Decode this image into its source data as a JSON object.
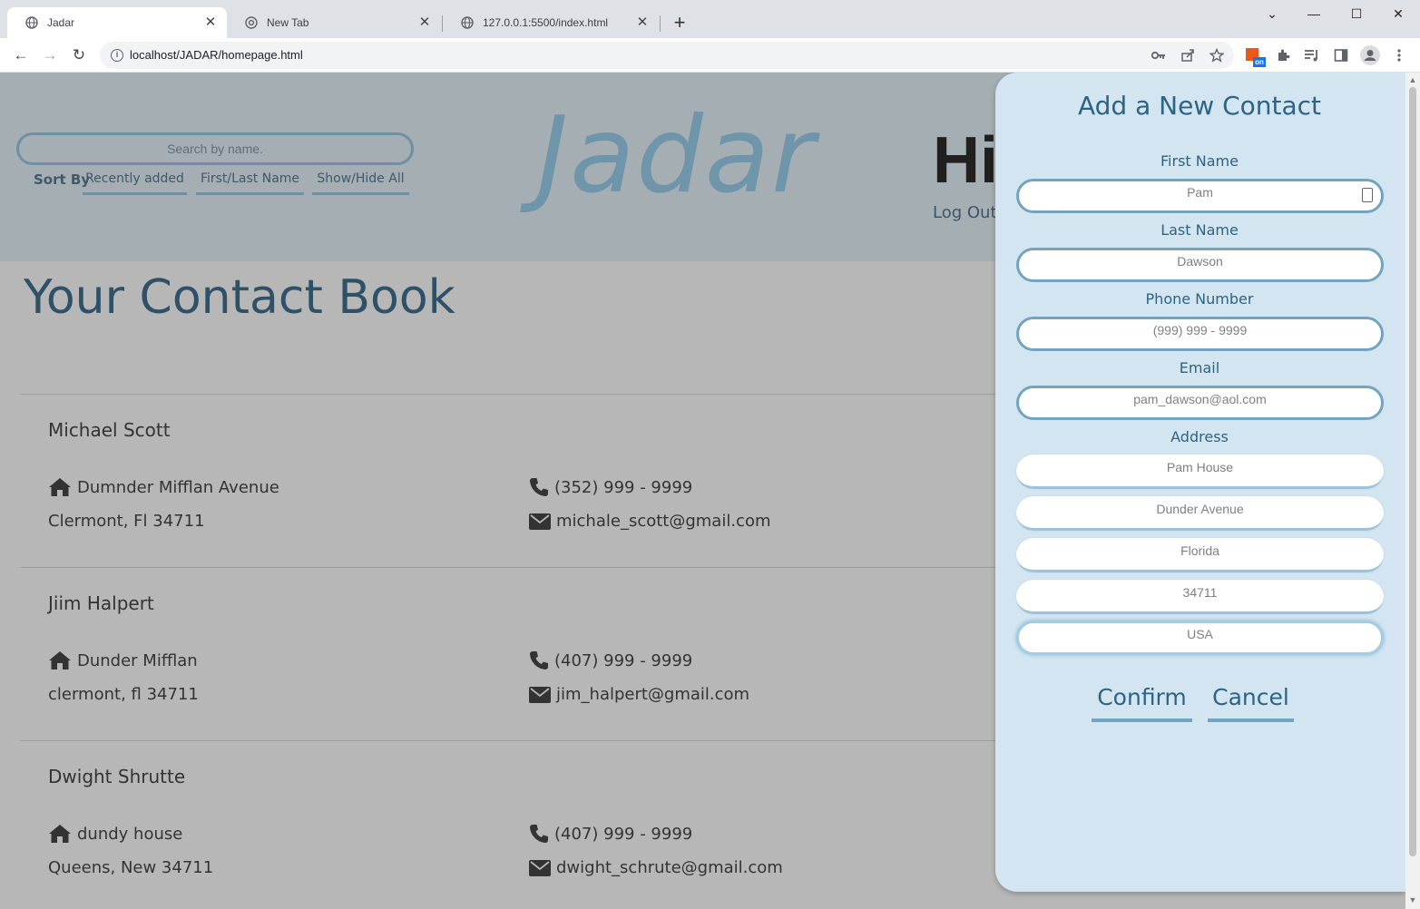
{
  "browser": {
    "tabs": [
      {
        "title": "Jadar",
        "close": "✕"
      },
      {
        "title": "New Tab",
        "close": "✕"
      },
      {
        "title": "127.0.0.1:5500/index.html",
        "close": "✕"
      }
    ],
    "new_tab": "+",
    "window": {
      "chevron": "⌄",
      "minimize": "—",
      "maximize": "☐",
      "close": "✕"
    },
    "nav": {
      "back": "←",
      "forward": "→",
      "reload": "↻"
    },
    "url": "localhost/JADAR/homepage.html",
    "info": "i",
    "icons": [
      "key-icon",
      "share-icon",
      "star-icon",
      "extension-on-icon",
      "puzzle-icon",
      "media-icon",
      "side-panel-icon",
      "profile-icon",
      "menu-icon"
    ],
    "extension_badge": "on"
  },
  "header": {
    "search_placeholder": "Search by name.",
    "sort_label": "Sort By",
    "sort_buttons": [
      "Recently added",
      "First/Last Name",
      "Show/Hide All"
    ],
    "logo": "Jadar",
    "greeting": "Hi",
    "logout": "Log Out"
  },
  "main": {
    "title": "Your Contact Book",
    "contacts": [
      {
        "name": "Michael Scott",
        "street": "Dumnder Mifflan Avenue",
        "city": "Clermont, Fl 34711",
        "phone": "(352) 999 - 9999",
        "email": "michale_scott@gmail.com"
      },
      {
        "name": "Jiim Halpert",
        "street": "Dunder Mifflan",
        "city": "clermont, fl 34711",
        "phone": "(407) 999 - 9999",
        "email": "jim_halpert@gmail.com"
      },
      {
        "name": "Dwight Shrutte",
        "street": "dundy house",
        "city": "Queens, New 34711",
        "phone": "(407) 999 - 9999",
        "email": "dwight_schrute@gmail.com"
      }
    ]
  },
  "panel": {
    "title": "Add a New Contact",
    "first_name": {
      "label": "First Name",
      "placeholder": "Pam"
    },
    "last_name": {
      "label": "Last Name",
      "placeholder": "Dawson"
    },
    "phone": {
      "label": "Phone Number",
      "placeholder": "(999) 999 - 9999"
    },
    "email": {
      "label": "Email",
      "placeholder": "pam_dawson@aol.com"
    },
    "address": {
      "label": "Address",
      "street_placeholder": "Pam House",
      "city_placeholder": "Dunder Avenue",
      "state_placeholder": "Florida",
      "zip_placeholder": "34711",
      "country_placeholder": "USA"
    },
    "confirm": "Confirm",
    "cancel": "Cancel"
  },
  "colors": {
    "header_bg": "#a5aeb3",
    "page_bg": "#b7b7b7",
    "panel_bg": "#d3e5f0",
    "accent": "#2d6383",
    "logo": "#6f95ab"
  }
}
